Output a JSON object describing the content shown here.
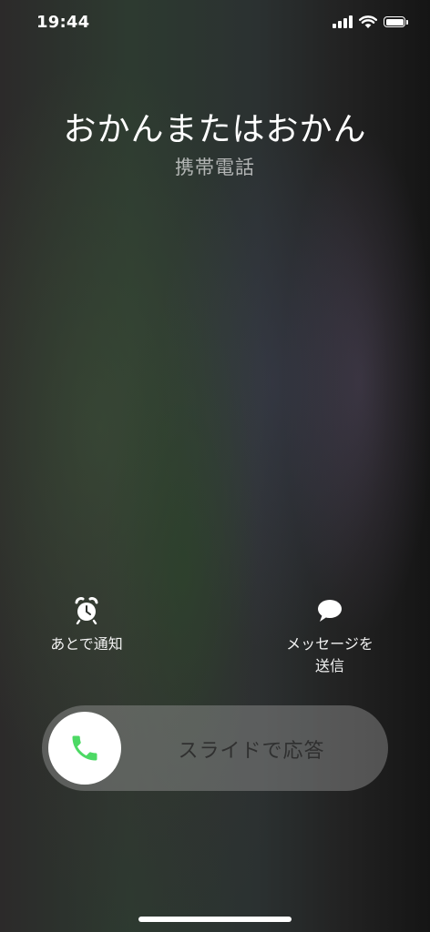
{
  "status_bar": {
    "time": "19:44",
    "icons": [
      "cellular-signal-icon",
      "wifi-icon",
      "battery-icon"
    ]
  },
  "caller": {
    "name": "おかんまたはおかん",
    "label": "携帯電話"
  },
  "actions": {
    "remind": {
      "label": "あとで通知",
      "icon": "alarm-clock-icon"
    },
    "message": {
      "label": "メッセージを\n送信",
      "icon": "speech-bubble-icon"
    }
  },
  "slider": {
    "text": "スライドで応答",
    "knob_icon": "phone-icon",
    "accent_color": "#4cd964"
  }
}
